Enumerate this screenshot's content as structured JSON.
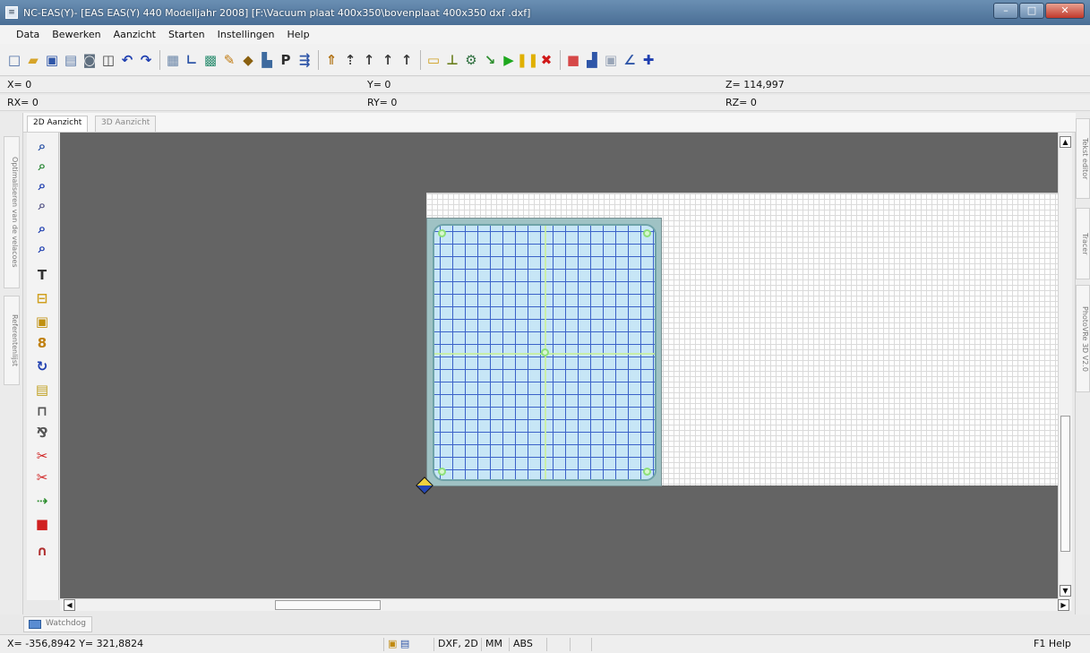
{
  "window": {
    "title": "NC-EAS(Y)- [EAS EAS(Y) 440 Modelljahr 2008] [F:\\Vacuum plaat 400x350\\bovenplaat 400x350 dxf .dxf]",
    "minimize_glyph": "–",
    "maximize_glyph": "□",
    "close_glyph": "✕"
  },
  "menu": [
    "Data",
    "Bewerken",
    "Aanzicht",
    "Starten",
    "Instellingen",
    "Help"
  ],
  "toolbar": {
    "icons": [
      {
        "name": "new-file-icon",
        "glyph": "□",
        "color": "#4f6fa6"
      },
      {
        "name": "open-folder-icon",
        "glyph": "▰",
        "color": "#d6a42a"
      },
      {
        "name": "save-icon",
        "glyph": "▣",
        "color": "#2f56a8"
      },
      {
        "name": "document-icon",
        "glyph": "▤",
        "color": "#5d7ba8"
      },
      {
        "name": "camera-icon",
        "glyph": "◙",
        "color": "#607080"
      },
      {
        "name": "copy-icon",
        "glyph": "◫",
        "color": "#444"
      },
      {
        "name": "undo-icon",
        "glyph": "↶",
        "color": "#1f3fb0"
      },
      {
        "name": "redo-icon",
        "glyph": "↷",
        "color": "#1f3fb0"
      },
      {
        "name": "sep",
        "glyph": "",
        "color": ""
      },
      {
        "name": "frame-icon",
        "glyph": "▦",
        "color": "#6b86a8"
      },
      {
        "name": "line-icon",
        "glyph": "∟",
        "color": "#2f56a8"
      },
      {
        "name": "grid-icon",
        "glyph": "▩",
        "color": "#2f8f72"
      },
      {
        "name": "wrench-icon",
        "glyph": "✎",
        "color": "#c07a10"
      },
      {
        "name": "tool-change-icon",
        "glyph": "◆",
        "color": "#8a6010"
      },
      {
        "name": "book-icon",
        "glyph": "▙",
        "color": "#3e6a9e"
      },
      {
        "name": "program-icon",
        "glyph": "P",
        "color": "#2d2d2d"
      },
      {
        "name": "spindle-icon",
        "glyph": "⇶",
        "color": "#2f56a8"
      },
      {
        "name": "sep",
        "glyph": "",
        "color": ""
      },
      {
        "name": "axis-home-icon",
        "glyph": "⇑",
        "color": "#b07010"
      },
      {
        "name": "axis-x-icon",
        "glyph": "⇡",
        "color": "#3a3a3a"
      },
      {
        "name": "axis-y-icon",
        "glyph": "↑",
        "color": "#3a3a3a"
      },
      {
        "name": "axis-z-icon",
        "glyph": "↑",
        "color": "#3a3a3a"
      },
      {
        "name": "axis-a-icon",
        "glyph": "↑",
        "color": "#3a3a3a"
      },
      {
        "name": "sep",
        "glyph": "",
        "color": ""
      },
      {
        "name": "measure-icon",
        "glyph": "▭",
        "color": "#d0a020"
      },
      {
        "name": "probe-icon",
        "glyph": "⊥",
        "color": "#6b8020"
      },
      {
        "name": "gear-icon",
        "glyph": "⚙",
        "color": "#2f6f3f"
      },
      {
        "name": "jump-icon",
        "glyph": "↘",
        "color": "#2f8f30"
      },
      {
        "name": "play-icon",
        "glyph": "▶",
        "color": "#1ea81e"
      },
      {
        "name": "pause-icon",
        "glyph": "❚❚",
        "color": "#e0b000"
      },
      {
        "name": "stop-icon",
        "glyph": "✖",
        "color": "#d01818"
      },
      {
        "name": "sep",
        "glyph": "",
        "color": ""
      },
      {
        "name": "record-icon",
        "glyph": "■",
        "color": "#d64848"
      },
      {
        "name": "spray-icon",
        "glyph": "▟",
        "color": "#2f56a8"
      },
      {
        "name": "dim-icon",
        "glyph": "▣",
        "color": "#9aa6b8"
      },
      {
        "name": "angle-icon",
        "glyph": "∠",
        "color": "#2f56a8"
      },
      {
        "name": "move-icon",
        "glyph": "✚",
        "color": "#1f3fb0"
      }
    ]
  },
  "coords1": {
    "x": "X= 0",
    "y": "Y= 0",
    "z": "Z= 114,997"
  },
  "coords2": {
    "rx": "RX= 0",
    "ry": "RY= 0",
    "rz": "RZ= 0"
  },
  "tabs": [
    "2D Aanzicht",
    "3D Aanzicht"
  ],
  "left_panel_tabs": [
    "Optimaliseren van de velacoes",
    "Referentenlijst"
  ],
  "right_panel_tabs": [
    "Tekst editor",
    "Tracer",
    "PhotoVRe 3D V2.0"
  ],
  "vertical_tools": [
    {
      "name": "zoom-window-icon",
      "glyph": "⌕",
      "color": "#2f56a8"
    },
    {
      "name": "zoom-all-icon",
      "glyph": "⌕",
      "color": "#2f8a3a"
    },
    {
      "name": "zoom-in-icon",
      "glyph": "⌕",
      "color": "#1f3fb0"
    },
    {
      "name": "zoom-out-icon",
      "glyph": "⌕",
      "color": "#5a5a8a"
    },
    {
      "name": "zoom-prev-icon",
      "glyph": "⌕",
      "color": "#1f3fb0"
    },
    {
      "name": "zoom-next-icon",
      "glyph": "⌕",
      "color": "#1f3fb0"
    },
    {
      "name": "text-tool-icon",
      "glyph": "T",
      "color": "#333"
    },
    {
      "name": "insert-icon",
      "glyph": "⊟",
      "color": "#d0a020"
    },
    {
      "name": "rect-select-icon",
      "glyph": "▣",
      "color": "#c09010"
    },
    {
      "name": "group-icon",
      "glyph": "8",
      "color": "#c08010"
    },
    {
      "name": "rotate-icon",
      "glyph": "↻",
      "color": "#1f3fb0"
    },
    {
      "name": "layer-icon",
      "glyph": "▤",
      "color": "#c0a020"
    },
    {
      "name": "drill-icon",
      "glyph": "⊓",
      "color": "#555"
    },
    {
      "name": "mirror-icon",
      "glyph": "⅋",
      "color": "#555"
    },
    {
      "name": "trim-icon",
      "glyph": "✂",
      "color": "#d02020"
    },
    {
      "name": "cut-icon",
      "glyph": "✂",
      "color": "#d02020"
    },
    {
      "name": "connect-icon",
      "glyph": "⇢",
      "color": "#2f8f30"
    },
    {
      "name": "stop-square-icon",
      "glyph": "■",
      "color": "#d02020"
    },
    {
      "name": "path-icon",
      "glyph": "∩",
      "color": "#b03030"
    }
  ],
  "watchdog": "Watchdog",
  "status": {
    "cursor": "X= -356,8942 Y= 321,8824",
    "format": "DXF, 2D",
    "unit": "MM",
    "mode": "ABS",
    "help": "F1 Help"
  }
}
